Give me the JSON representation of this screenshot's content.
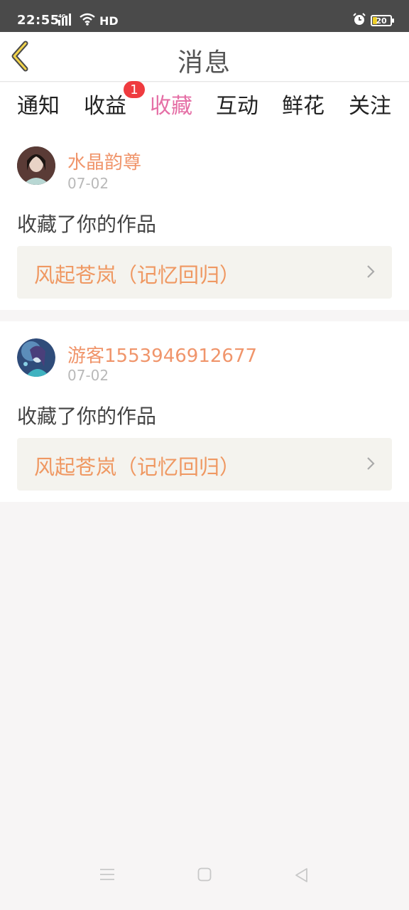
{
  "status_bar": {
    "time": "22:55",
    "network": "4G",
    "hd": "HD",
    "battery": "20",
    "icons": [
      "signal-icon",
      "wifi-icon",
      "alarm-icon",
      "battery-icon"
    ]
  },
  "header": {
    "title": "消息",
    "back_icon": "chevron-left-icon"
  },
  "tabs": [
    {
      "label": "通知",
      "active": false
    },
    {
      "label": "收益",
      "active": false,
      "badge": "1"
    },
    {
      "label": "收藏",
      "active": true
    },
    {
      "label": "互动",
      "active": false
    },
    {
      "label": "鲜花",
      "active": false
    },
    {
      "label": "关注",
      "active": false
    }
  ],
  "messages": [
    {
      "username": "水晶韵尊",
      "date": "07-02",
      "action": "收藏了你的作品",
      "work_title": "风起苍岚（记忆回归）"
    },
    {
      "username": "游客1553946912677",
      "date": "07-02",
      "action": "收藏了你的作品",
      "work_title": "风起苍岚（记忆回归）"
    }
  ],
  "colors": {
    "accent": "#e56fa6",
    "username": "#f0956b",
    "badge": "#ef3b3f",
    "link_bg": "#f4f3ee"
  },
  "nav": [
    "menu-icon",
    "home-icon",
    "back-triangle-icon"
  ]
}
